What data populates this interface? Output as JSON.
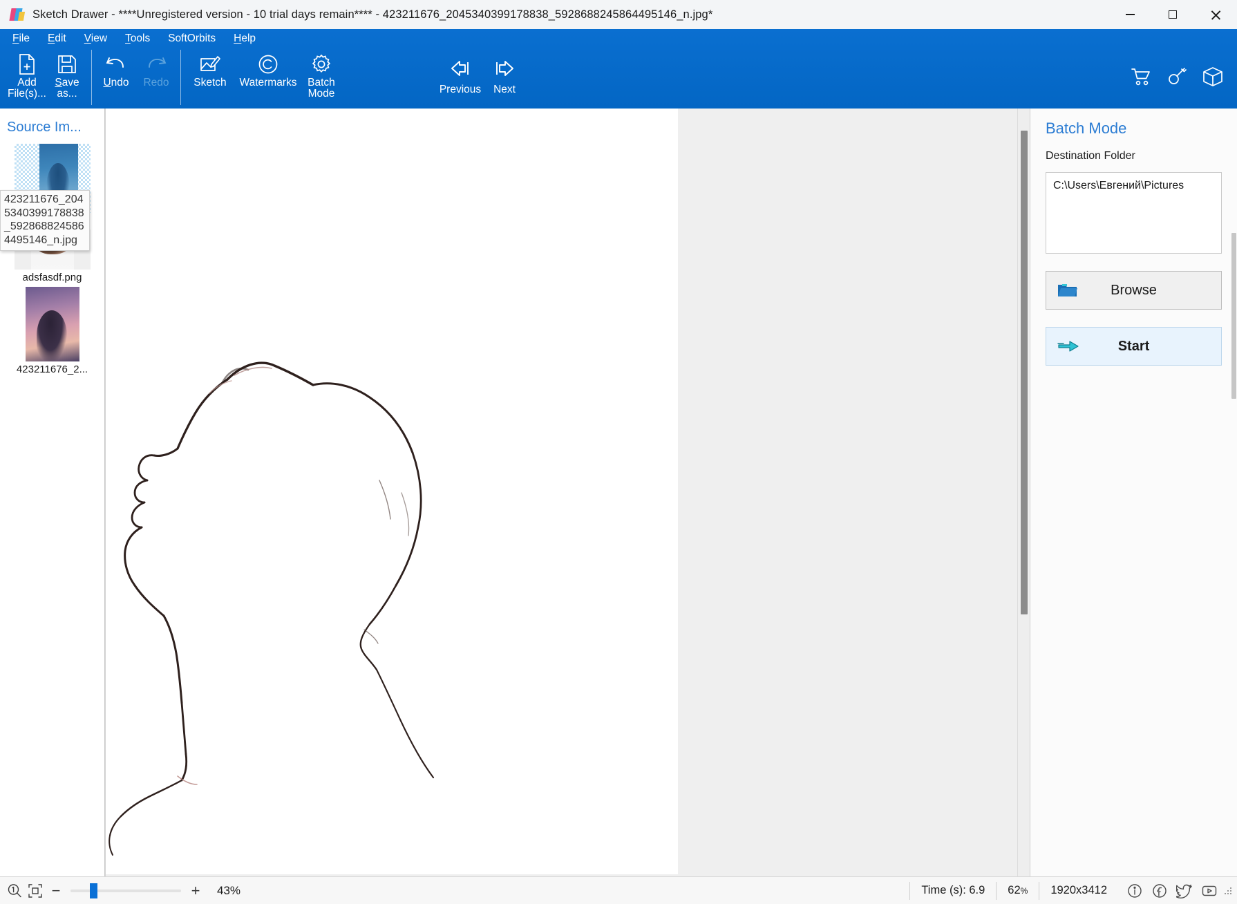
{
  "window": {
    "app_icon": "sketch-drawer-logo-icon",
    "title": "Sketch Drawer - ****Unregistered version - 10 trial days remain**** - 423211676_2045340399178838_5928688245864495146_n.jpg*",
    "controls": {
      "minimize": "minimize-icon",
      "maximize": "maximize-icon",
      "close": "close-icon"
    }
  },
  "menu": {
    "items": [
      {
        "label": "File",
        "accel": "F"
      },
      {
        "label": "Edit",
        "accel": "E"
      },
      {
        "label": "View",
        "accel": "V"
      },
      {
        "label": "Tools",
        "accel": "T"
      },
      {
        "label": "SoftOrbits",
        "accel": ""
      },
      {
        "label": "Help",
        "accel": "H"
      }
    ]
  },
  "toolbar": {
    "add_files_line1": "Add",
    "add_files_line2": "File(s)...",
    "save_as_line1": "Save",
    "save_as_line2": "as...",
    "undo": "Undo",
    "redo": "Redo",
    "sketch": "Sketch",
    "watermarks": "Watermarks",
    "batch_line1": "Batch",
    "batch_line2": "Mode",
    "previous": "Previous",
    "next": "Next",
    "icons": {
      "add": "add-file-icon",
      "save": "save-disk-icon",
      "undo": "undo-arrow-icon",
      "redo": "redo-arrow-icon",
      "sketch": "sketch-pencil-image-icon",
      "watermarks": "copyright-icon",
      "batch": "gear-icon",
      "previous": "arrow-left-icon",
      "next": "arrow-right-icon",
      "cart": "shopping-cart-icon",
      "key": "key-icon",
      "box": "package-box-icon"
    }
  },
  "source_panel": {
    "header": "Source Im...",
    "items": [
      {
        "label": "adsfasdf.png",
        "thumb": "thumbnail-transparent-portrait"
      },
      {
        "label": "adsfasdf.png",
        "thumb": "thumbnail-small-portrait"
      },
      {
        "label": "423211676_2...",
        "thumb": "thumbnail-sunset-portrait"
      }
    ],
    "tooltip": "423211676_2045340399178838_5928688245864495146_n.jpg"
  },
  "canvas": {
    "artwork": "pencil-sketch-head-profile"
  },
  "batch_panel": {
    "title": "Batch Mode",
    "destination_label": "Destination Folder",
    "destination_value": "C:\\Users\\Евгений\\Pictures",
    "browse_label": "Browse",
    "browse_icon": "folder-open-icon",
    "start_label": "Start",
    "start_icon": "double-arrow-right-icon"
  },
  "status_bar": {
    "actual_size_icon": "zoom-1to1-icon",
    "fit_icon": "fit-to-window-icon",
    "zoom_out_icon": "minus-icon",
    "zoom_in_icon": "plus-icon",
    "zoom_percent": "43%",
    "time_label": "Time (s): 6.9",
    "progress_percent_value": "62",
    "progress_percent_unit": "%",
    "dimensions": "1920x3412",
    "info_icon": "info-icon",
    "facebook_icon": "facebook-icon",
    "twitter_icon": "twitter-icon",
    "youtube_icon": "youtube-icon"
  },
  "colors": {
    "ribbon_blue": "#0468c8",
    "accent_link": "#2b7cd3",
    "start_button_bg": "#e8f3fd",
    "start_arrow": "#19b6c8",
    "folder_icon": "#1a6fb5"
  }
}
